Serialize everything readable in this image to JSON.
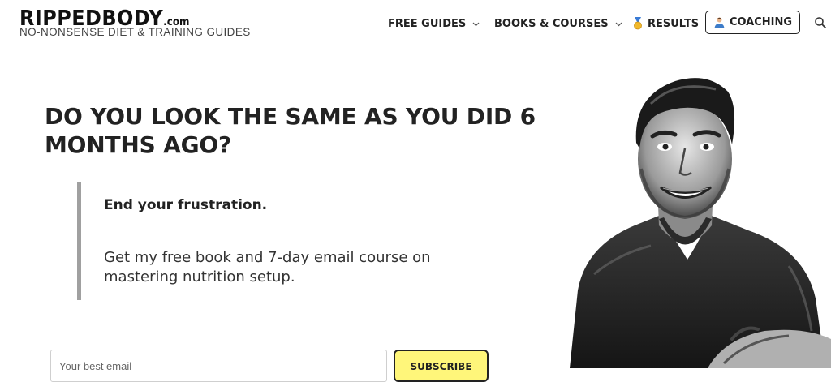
{
  "header": {
    "logo_text": "RIPPEDBODY",
    "logo_suffix": ".com",
    "tagline": "NO-NONSENSE DIET & TRAINING GUIDES",
    "nav": [
      {
        "label": "FREE GUIDES",
        "icon": "chevron-down-icon"
      },
      {
        "label": "BOOKS & COURSES",
        "icon": "chevron-down-icon"
      },
      {
        "label": "RESULTS",
        "icon": "medal-icon"
      }
    ],
    "coaching_label": "COACHING",
    "search_icon": "search-icon"
  },
  "hero": {
    "headline": "DO YOU LOOK THE SAME AS YOU DID 6 MONTHS AGO?",
    "quote_title": "End your frustration.",
    "quote_body": "Get my free book and 7-day email course on mastering nutrition setup.",
    "email_placeholder": "Your best email",
    "subscribe_label": "SUBSCRIBE"
  },
  "colors": {
    "subscribe_bg": "#fff67a",
    "quote_bar": "#a0a0a0",
    "text": "#222222"
  }
}
